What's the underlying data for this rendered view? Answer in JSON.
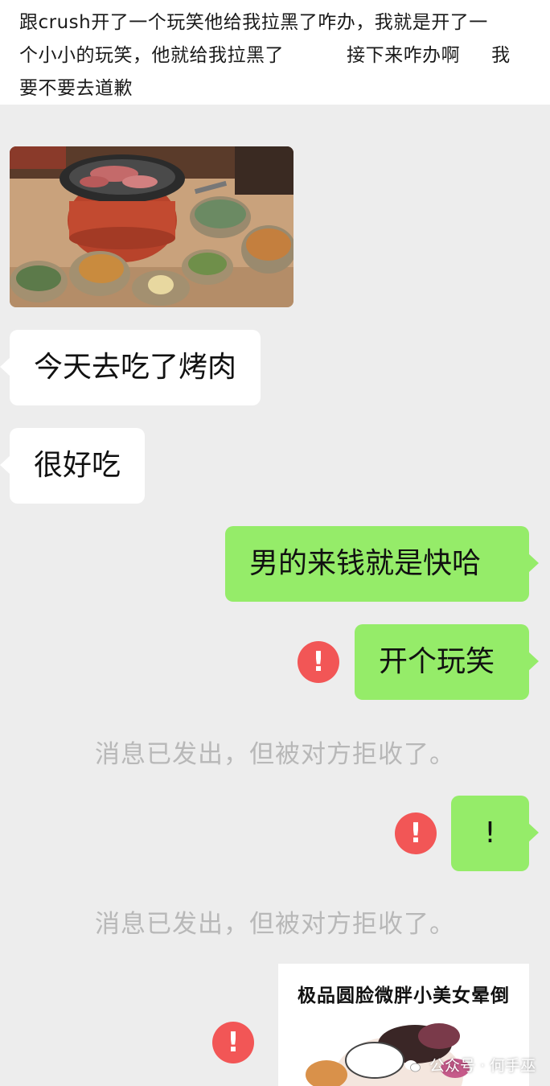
{
  "post": {
    "text_line1": "跟crush开了一个玩笑他给我拉黑了咋办，我就是开了一",
    "text_line2": "个小小的玩笑，他就给我拉黑了          接下来咋办啊     我",
    "text_line3": "要不要去道歉"
  },
  "chat": {
    "messages": [
      {
        "side": "left",
        "text": "今天去吃了烤肉"
      },
      {
        "side": "left",
        "text": "很好吃"
      },
      {
        "side": "right",
        "text": "男的来钱就是快哈"
      },
      {
        "side": "right",
        "text": "开个玩笑",
        "failed": true
      },
      {
        "side": "right",
        "text": "!",
        "failed": true
      }
    ],
    "system_notice_1": "消息已发出，但被对方拒收了。",
    "system_notice_2": "消息已发出，但被对方拒收了。",
    "error_icon_glyph": "!",
    "sticker_caption": "极品圆脸微胖小美女晕倒"
  },
  "watermark": {
    "icon": "wechat-icon",
    "text": "公众号 · 何手巫"
  },
  "colors": {
    "chat_background": "#ededed",
    "sent_bubble": "#95ec69",
    "received_bubble": "#ffffff",
    "error_red": "#f25656",
    "system_text": "#b8b8b8"
  }
}
